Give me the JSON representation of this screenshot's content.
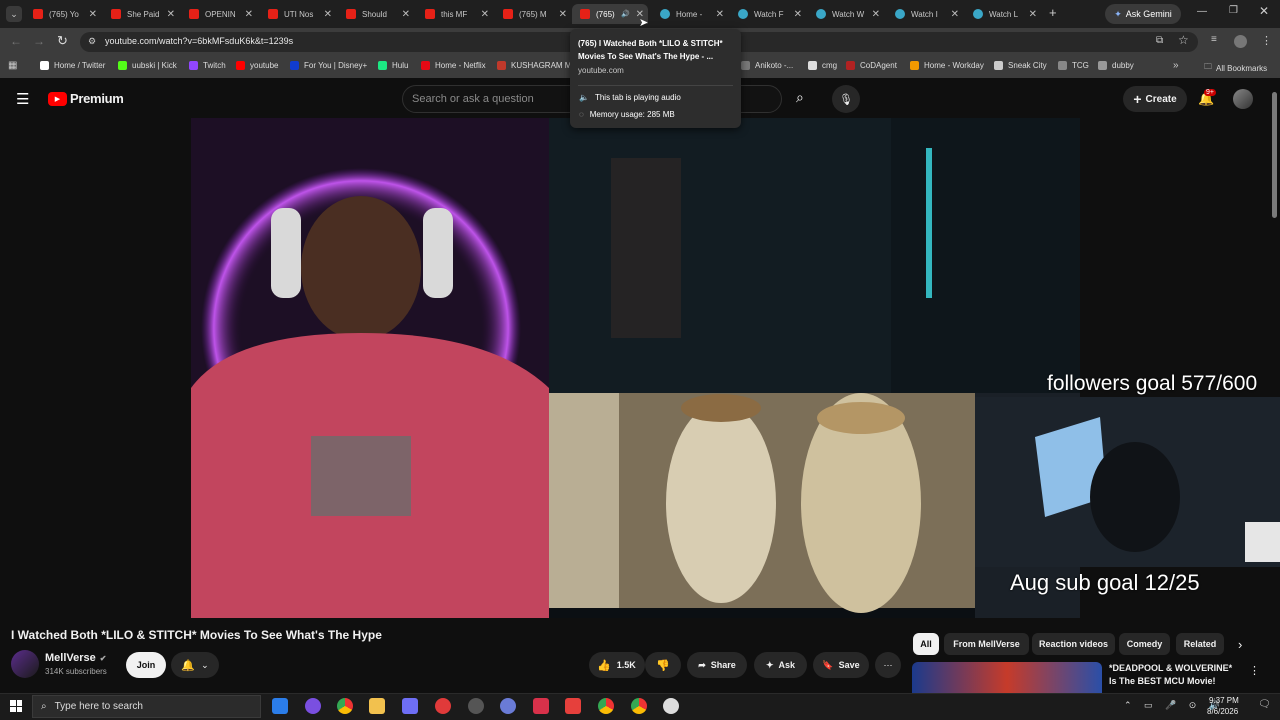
{
  "browser": {
    "tabs": [
      {
        "label": "(765) Yo",
        "kind": "yt"
      },
      {
        "label": "She Paid",
        "kind": "yt"
      },
      {
        "label": "OPENIN",
        "kind": "yt"
      },
      {
        "label": "UTI Nos",
        "kind": "yt"
      },
      {
        "label": "Should",
        "kind": "yt"
      },
      {
        "label": "this MF",
        "kind": "yt"
      },
      {
        "label": "(765) M",
        "kind": "yt"
      },
      {
        "label": "(765)",
        "kind": "yt"
      },
      {
        "label": "Home -",
        "kind": "web"
      },
      {
        "label": "Watch F",
        "kind": "web"
      },
      {
        "label": "Watch W",
        "kind": "web"
      },
      {
        "label": "Watch I",
        "kind": "web"
      },
      {
        "label": "Watch L",
        "kind": "web"
      }
    ],
    "ask_gemini": "Ask Gemini",
    "url": "youtube.com/watch?v=6bkMFsduK6k&t=1239s",
    "bookmarks": [
      {
        "label": "Home / Twitter",
        "color": "#ffffff"
      },
      {
        "label": "uubski | Kick",
        "color": "#53fc18"
      },
      {
        "label": "Twitch",
        "color": "#9146ff"
      },
      {
        "label": "youtube",
        "color": "#ff0000"
      },
      {
        "label": "For You | Disney+",
        "color": "#113ccf"
      },
      {
        "label": "Hulu",
        "color": "#1ce783"
      },
      {
        "label": "Home - Netflix",
        "color": "#e50914"
      },
      {
        "label": "KUSHAGRAM M",
        "color": "#c0392b"
      },
      {
        "label": "Anikoto -...",
        "color": "#7a7a7a"
      },
      {
        "label": "cmg",
        "color": "#dddddd"
      },
      {
        "label": "CoDAgent",
        "color": "#b22222"
      },
      {
        "label": "Home - Workday",
        "color": "#f29900"
      },
      {
        "label": "Sneak City",
        "color": "#cccccc"
      },
      {
        "label": "TCG",
        "color": "#888888"
      },
      {
        "label": "dubby",
        "color": "#999999"
      }
    ],
    "all_bookmarks": "All Bookmarks",
    "tooltip": {
      "title": "(765) I Watched Both *LILO & STITCH* Movies To See What's The Hype - ...",
      "domain": "youtube.com",
      "audio": "This tab is playing audio",
      "memory": "Memory usage: 285 MB"
    }
  },
  "youtube": {
    "logo": "Premium",
    "search_placeholder": "Search or ask a question",
    "create_label": "Create",
    "notifications_badge": "9+",
    "overlays": {
      "followers": "followers goal 577/600",
      "subs": "Aug sub goal 12/25"
    },
    "video_title": "I Watched Both *LILO & STITCH* Movies To See What's The Hype",
    "channel": {
      "name": "MellVerse",
      "subscribers": "314K subscribers"
    },
    "join_label": "Join",
    "actions": {
      "likes": "1.5K",
      "share": "Share",
      "ask": "Ask",
      "save": "Save"
    },
    "chips": [
      "All",
      "From MellVerse",
      "Reaction videos",
      "Comedy",
      "Related"
    ],
    "recommended_title": "*DEADPOOL & WOLVERINE* Is The BEST MCU Movie!"
  },
  "taskbar": {
    "search_placeholder": "Type here to search",
    "time": "9:37 PM",
    "date": "8/6/2026"
  }
}
